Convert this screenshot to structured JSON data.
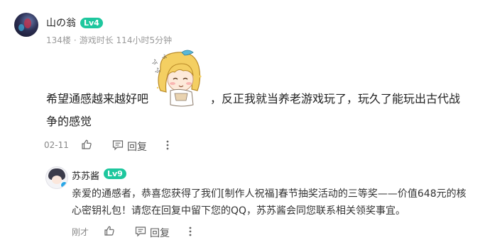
{
  "comment": {
    "username": "山の翁",
    "level": "Lv4",
    "floor": "134楼",
    "separator": "·",
    "playtime": "游戏时长 114小时5分钟",
    "body_part1": "希望通感越来越好吧",
    "body_part2": "，反正我就当养老游戏玩了，玩久了能玩出古代战",
    "body_part3": "争的感觉",
    "date": "02-11",
    "reply_label": "回复",
    "sticker_name": "sticker-blonde-girl-icon"
  },
  "reply": {
    "username": "苏苏酱",
    "level": "Lv9",
    "line1": "亲爱的通感者，恭喜您获得了我们[制作人祝福]春节抽奖活动的三等奖——价值648元的核",
    "line2": "心密钥礼包！请您在回复中留下您的QQ，苏苏酱会同您联系相关领奖事宜。",
    "time": "刚才",
    "reply_label": "回复"
  },
  "colors": {
    "level_badge": "#1ec79e",
    "meta_text": "#999999"
  }
}
